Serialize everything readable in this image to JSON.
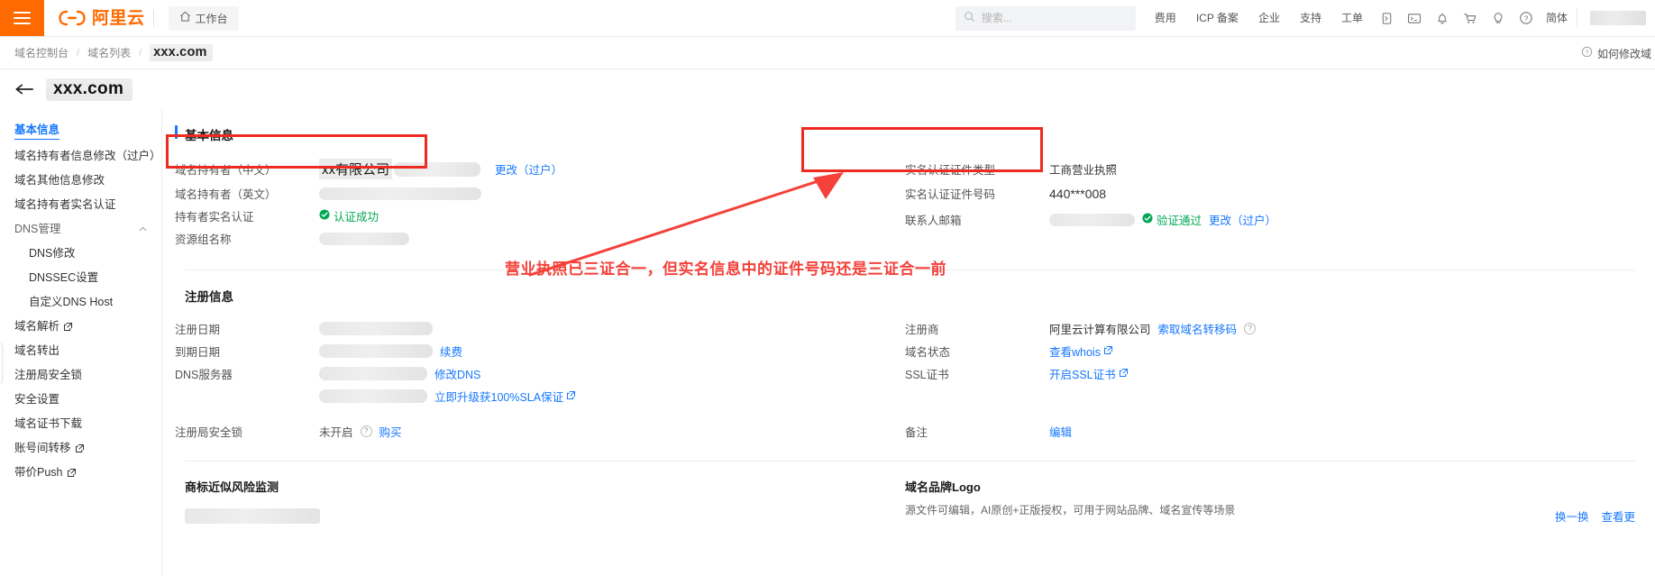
{
  "topbar": {
    "menu_icon": "hamburger-icon",
    "brand": "阿里云",
    "workbench": "工作台",
    "search_placeholder": "搜索...",
    "search_value": "",
    "nav": [
      {
        "label": "费用"
      },
      {
        "label": "ICP 备案"
      },
      {
        "label": "企业"
      },
      {
        "label": "支持"
      },
      {
        "label": "工单"
      }
    ],
    "icons": [
      {
        "name": "app-window-icon",
        "glyph": "▣"
      },
      {
        "name": "terminal-icon",
        "glyph": "▭"
      },
      {
        "name": "bell-icon",
        "glyph": "🔔"
      },
      {
        "name": "cart-icon",
        "glyph": "🛒"
      },
      {
        "name": "lightbulb-icon",
        "glyph": "💡"
      },
      {
        "name": "help-circle-icon",
        "glyph": "?"
      }
    ],
    "language": "简体"
  },
  "breadcrumb": {
    "items": [
      "域名控制台",
      "域名列表"
    ],
    "separator": "/",
    "current": "xxx.com",
    "help_link": "如何修改域"
  },
  "page": {
    "back_icon": "arrow-left-icon",
    "title": "xxx.com"
  },
  "sidebar": {
    "items": [
      {
        "label": "基本信息",
        "active": true,
        "level": 0,
        "external": false
      },
      {
        "label": "域名持有者信息修改（过户）",
        "active": false,
        "level": 0,
        "external": false
      },
      {
        "label": "域名其他信息修改",
        "active": false,
        "level": 0,
        "external": false
      },
      {
        "label": "域名持有者实名认证",
        "active": false,
        "level": 0,
        "external": false
      },
      {
        "label": "DNS管理",
        "active": false,
        "level": 0,
        "external": false,
        "group": true
      },
      {
        "label": "DNS修改",
        "active": false,
        "level": 1,
        "external": false
      },
      {
        "label": "DNSSEC设置",
        "active": false,
        "level": 1,
        "external": false
      },
      {
        "label": "自定义DNS Host",
        "active": false,
        "level": 1,
        "external": false
      },
      {
        "label": "域名解析",
        "active": false,
        "level": 0,
        "external": true
      },
      {
        "label": "域名转出",
        "active": false,
        "level": 0,
        "external": false
      },
      {
        "label": "注册局安全锁",
        "active": false,
        "level": 0,
        "external": false
      },
      {
        "label": "安全设置",
        "active": false,
        "level": 0,
        "external": false
      },
      {
        "label": "域名证书下载",
        "active": false,
        "level": 0,
        "external": false
      },
      {
        "label": "账号间转移",
        "active": false,
        "level": 0,
        "external": true
      },
      {
        "label": "带价Push",
        "active": false,
        "level": 0,
        "external": true
      }
    ],
    "collapse_icon": "chevron-right-icon"
  },
  "basic_info": {
    "heading": "基本信息",
    "left_rows": [
      {
        "label": "域名持有者（中文）",
        "value": "xx有限公司",
        "redacted": true,
        "action": "更改（过户）"
      },
      {
        "label": "域名持有者（英文）",
        "value": "",
        "redacted": true,
        "action": ""
      },
      {
        "label": "持有者实名认证",
        "value": "认证成功",
        "status": "success",
        "action": ""
      },
      {
        "label": "资源组名称",
        "value": "",
        "redacted": true,
        "action": ""
      }
    ],
    "right_rows": [
      {
        "label": "实名认证证件类型",
        "value": "工商营业执照"
      },
      {
        "label": "实名认证证件号码",
        "value": "440***008"
      },
      {
        "label": "联系人邮箱",
        "value": "",
        "redacted": true,
        "status_text": "验证通过",
        "action": "更改（过户）"
      }
    ]
  },
  "register_info": {
    "heading": "注册信息",
    "left_rows": [
      {
        "label": "注册日期",
        "value": "",
        "redacted": true,
        "links": []
      },
      {
        "label": "到期日期",
        "value": "",
        "redacted": true,
        "links": [
          "续费"
        ]
      },
      {
        "label": "DNS服务器",
        "value": "",
        "redacted": true,
        "links": [
          "修改DNS"
        ]
      },
      {
        "label": "",
        "value": "",
        "redacted": true,
        "links": [
          "立即升级获100%SLA保证"
        ]
      },
      {
        "label": "注册局安全锁",
        "value": "未开启",
        "redacted": false,
        "links": [
          "购买"
        ],
        "help": true
      }
    ],
    "right_rows": [
      {
        "label": "注册商",
        "value": "阿里云计算有限公司",
        "links": [
          "索取域名转移码"
        ],
        "help": true
      },
      {
        "label": "域名状态",
        "value": "",
        "links": [
          "查看whois"
        ]
      },
      {
        "label": "SSL证书",
        "value": "",
        "links": [
          "开启SSL证书"
        ]
      },
      {
        "label": "备注",
        "value": "",
        "links": [
          "编辑"
        ]
      }
    ]
  },
  "trademark": {
    "heading": "商标近似风险监测"
  },
  "brand_logo": {
    "heading": "域名品牌Logo",
    "description": "源文件可编辑，AI原创+正版授权，可用于网站品牌、域名宣传等场景",
    "actions": [
      "换一换",
      "查看更"
    ]
  },
  "annotation": {
    "text": "营业执照已三证合一，但实名信息中的证件号码还是三证合一前",
    "color": "#f4413a"
  },
  "colors": {
    "brand_orange": "#ff6a00",
    "link_blue": "#1677ff",
    "success_green": "#00a854",
    "annotation_red": "#ee2b20"
  }
}
